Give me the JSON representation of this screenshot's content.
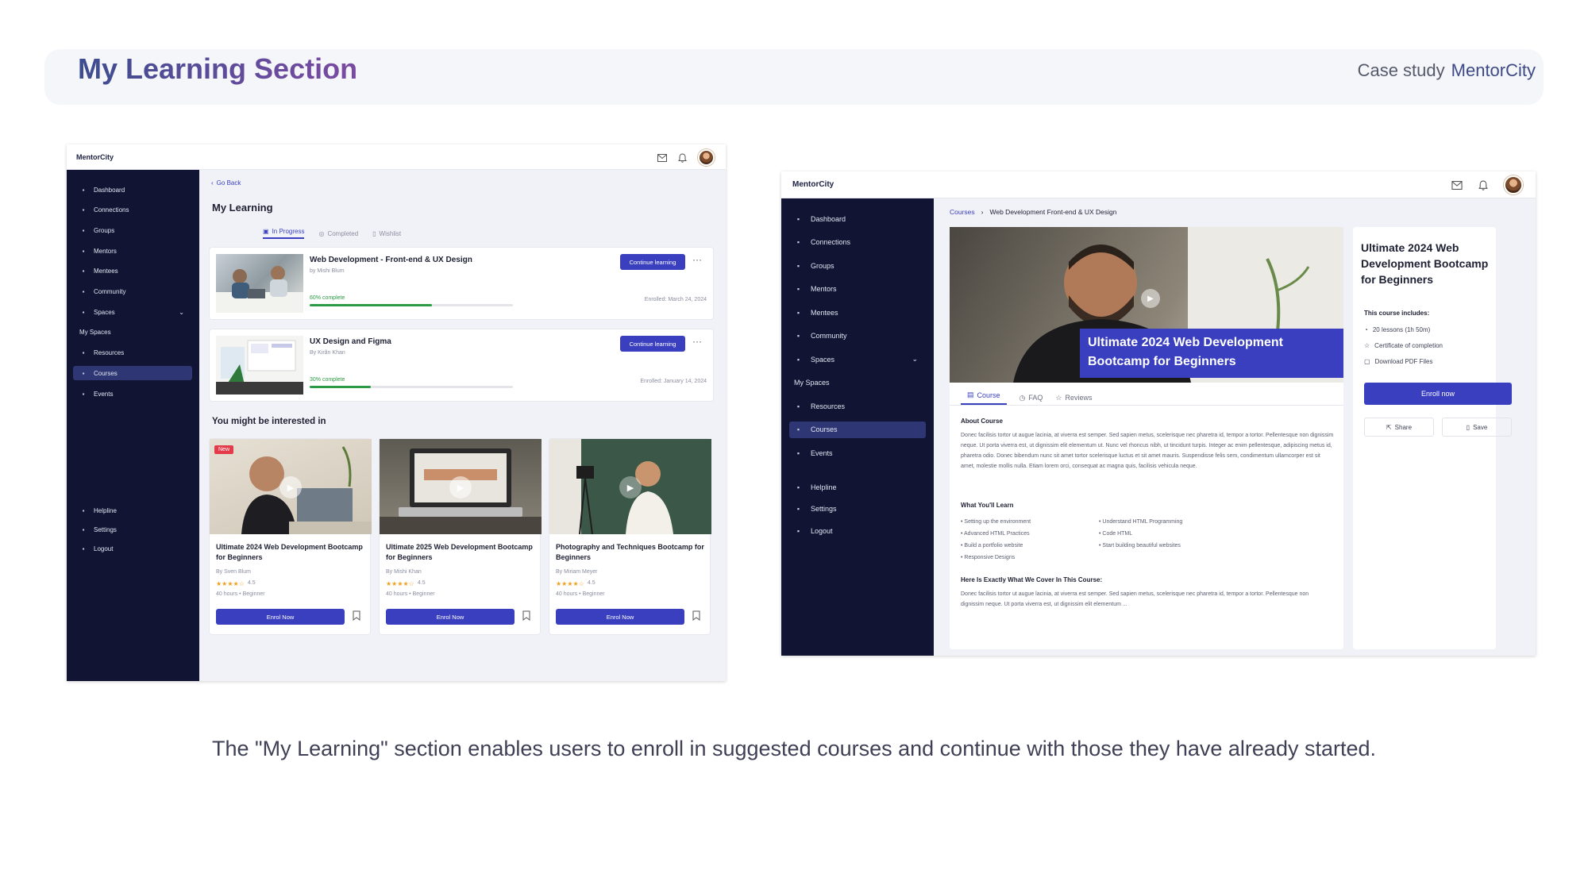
{
  "header": {
    "title": "My Learning Section",
    "case_study_label": "Case study",
    "brand": "MentorCity"
  },
  "caption": "The \"My Learning\" section enables users to enroll in suggested courses and continue with those they have already started.",
  "sidebar": {
    "items": [
      {
        "label": "Dashboard",
        "icon": "dashboard-icon"
      },
      {
        "label": "Connections",
        "icon": "users-icon"
      },
      {
        "label": "Groups",
        "icon": "group-icon"
      },
      {
        "label": "Mentors",
        "icon": "mentor-icon"
      },
      {
        "label": "Mentees",
        "icon": "graduation-cap-icon"
      },
      {
        "label": "Community",
        "icon": "chat-icon"
      },
      {
        "label": "Spaces",
        "icon": "spaces-icon"
      }
    ],
    "section_label": "My Spaces",
    "space_items": [
      {
        "label": "Resources",
        "icon": "document-icon"
      },
      {
        "label": "Courses",
        "icon": "book-icon"
      },
      {
        "label": "Events",
        "icon": "calendar-icon"
      }
    ],
    "bottom_items": [
      {
        "label": "Helpline",
        "icon": "lifebuoy-icon"
      },
      {
        "label": "Settings",
        "icon": "gear-icon"
      },
      {
        "label": "Logout",
        "icon": "logout-icon"
      }
    ]
  },
  "screen1": {
    "logo": "MentorCity",
    "back_label": "Go Back",
    "page_title": "My Learning",
    "tabs": [
      "In Progress",
      "Completed",
      "Wishlist"
    ],
    "courses": [
      {
        "title": "Web Development - Front-end & UX Design",
        "author": "by Mishi Blum",
        "progress_label": "60% complete",
        "progress": 0.6,
        "enrolled": "Enrolled: March 24, 2024",
        "cta": "Continue learning"
      },
      {
        "title": "UX Design and Figma",
        "author": "By Kirãn Khan",
        "progress_label": "30% complete",
        "progress": 0.3,
        "enrolled": "Enrolled: January 14, 2024",
        "cta": "Continue learning"
      }
    ],
    "suggest_title": "You might be interested in",
    "suggestions": [
      {
        "badge": "New",
        "title": "Ultimate 2024 Web Development Bootcamp for Beginners",
        "author": "By Sven Blum",
        "rating": "4.5",
        "stars": 4,
        "meta": "40 hours • Beginner",
        "cta": "Enrol Now"
      },
      {
        "badge": "",
        "title": "Ultimate 2025 Web Development Bootcamp for Beginners",
        "author": "By Mishi Khan",
        "rating": "4.5",
        "stars": 4,
        "meta": "40 hours • Beginner",
        "cta": "Enrol Now"
      },
      {
        "badge": "",
        "title": "Photography and Techniques Bootcamp for Beginners",
        "author": "By Miriam Meyer",
        "rating": "4.5",
        "stars": 4,
        "meta": "40 hours • Beginner",
        "cta": "Enrol Now"
      }
    ]
  },
  "screen2": {
    "logo": "MentorCity",
    "breadcrumb": [
      "Courses",
      "Web Development Front-end & UX Design"
    ],
    "hero_title": "Ultimate 2024 Web Development Bootcamp for Beginners",
    "tabs": [
      "Course",
      "FAQ",
      "Reviews"
    ],
    "about_heading": "About Course",
    "about_text": "Donec facilisis tortor ut augue lacinia, at viverra est semper. Sed sapien metus, scelerisque nec pharetra id, tempor a tortor. Pellentesque non dignissim neque. Ut porta viverra est, ut dignissim elit elementum ut. Nunc vel rhoncus nibh, ut tincidunt turpis. Integer ac enim pellentesque, adipiscing metus id, pharetra odio. Donec bibendum nunc sit amet tortor scelerisque luctus et sit amet mauris. Suspendisse felis sem, condimentum ullamcorper est sit amet, molestie mollis nulla. Etiam lorem orci, consequat ac magna quis, facilisis vehicula neque.",
    "learn_heading": "What You'll Learn",
    "learn_left": [
      "Setting up the environment",
      "Advanced HTML Practices",
      "Build a portfolio website",
      "Responsive Designs"
    ],
    "learn_right": [
      "Understand HTML Programming",
      "Code HTML",
      "Start building beautiful websites"
    ],
    "cover_heading": "Here Is Exactly What We Cover In This Course:",
    "cover_text": "Donec facilisis tortor ut augue lacinia, at viverra est semper. Sed sapien metus, scelerisque nec pharetra id, tempor a tortor. Pellentesque non dignissim neque. Ut porta viverra est, ut dignissim elit elementum ...",
    "side_title": "Ultimate 2024 Web Development Bootcamp for Beginners",
    "includes_label": "This course includes:",
    "includes": [
      {
        "label": "20 lessons (1h 50m)",
        "icon": "clock-icon"
      },
      {
        "label": "Certificate of completion",
        "icon": "certificate-icon"
      },
      {
        "label": "Download PDF Files",
        "icon": "file-icon"
      }
    ],
    "enroll_label": "Enroll now",
    "share_label": "Share",
    "save_label": "Save"
  },
  "colors": {
    "sidebar": "#111433",
    "accent": "#3a3fc0",
    "progress": "#2d9a45",
    "active_nav": "#2e3774"
  }
}
